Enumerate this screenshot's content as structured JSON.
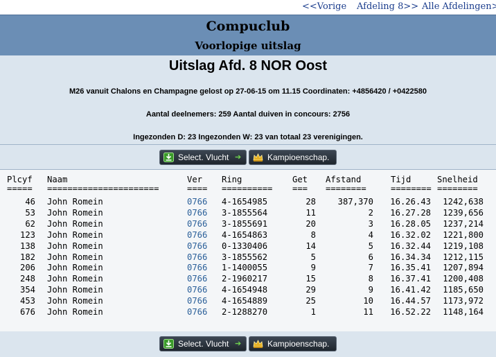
{
  "nav": {
    "prev": "<<Vorige",
    "dept": "Afdeling 8>>",
    "all": "Alle Afdelingen>>"
  },
  "header": {
    "title": "Compuclub",
    "subtitle": "Voorlopige uitslag"
  },
  "info": {
    "heading": "Uitslag Afd. 8 NOR Oost",
    "line1": "M26 vanuit Chalons en Champagne gelost op 27-06-15 om 11.15 Coordinaten: +4856420 / +0422580",
    "line2": "Aantal deelnemers: 259 Aantal duiven in concours: 2756",
    "line3": "Ingezonden D: 23 Ingezonden W: 23 van totaal 23 verenigingen."
  },
  "buttons": {
    "select": "Select. Vlucht",
    "kampioen": "Kampioenschap."
  },
  "table": {
    "headers": [
      "Plcyf",
      "Naam",
      "Ver",
      "Ring",
      "Get",
      "Afstand",
      "Tijd",
      "Snelheid"
    ],
    "underlines": [
      "=====",
      "======================",
      "====",
      "==========",
      "===",
      "========",
      "========",
      "========"
    ],
    "rows": [
      [
        "46",
        "John Romein",
        "0766",
        "4-1654985",
        "28",
        "387,370",
        "16.26.43",
        "1242,638"
      ],
      [
        "53",
        "John Romein",
        "0766",
        "3-1855564",
        "11",
        "2",
        "16.27.28",
        "1239,656"
      ],
      [
        "62",
        "John Romein",
        "0766",
        "3-1855691",
        "20",
        "3",
        "16.28.05",
        "1237,214"
      ],
      [
        "123",
        "John Romein",
        "0766",
        "4-1654863",
        "8",
        "4",
        "16.32.02",
        "1221,800"
      ],
      [
        "138",
        "John Romein",
        "0766",
        "0-1330406",
        "14",
        "5",
        "16.32.44",
        "1219,108"
      ],
      [
        "182",
        "John Romein",
        "0766",
        "3-1855562",
        "5",
        "6",
        "16.34.34",
        "1212,115"
      ],
      [
        "206",
        "John Romein",
        "0766",
        "1-1400055",
        "9",
        "7",
        "16.35.41",
        "1207,894"
      ],
      [
        "248",
        "John Romein",
        "0766",
        "2-1960217",
        "15",
        "8",
        "16.37.41",
        "1200,408"
      ],
      [
        "354",
        "John Romein",
        "0766",
        "4-1654948",
        "29",
        "9",
        "16.41.42",
        "1185,650"
      ],
      [
        "453",
        "John Romein",
        "0766",
        "4-1654889",
        "25",
        "10",
        "16.44.57",
        "1173,972"
      ],
      [
        "676",
        "John Romein",
        "0766",
        "2-1288270",
        "1",
        "11",
        "16.52.22",
        "1148,164"
      ]
    ]
  }
}
